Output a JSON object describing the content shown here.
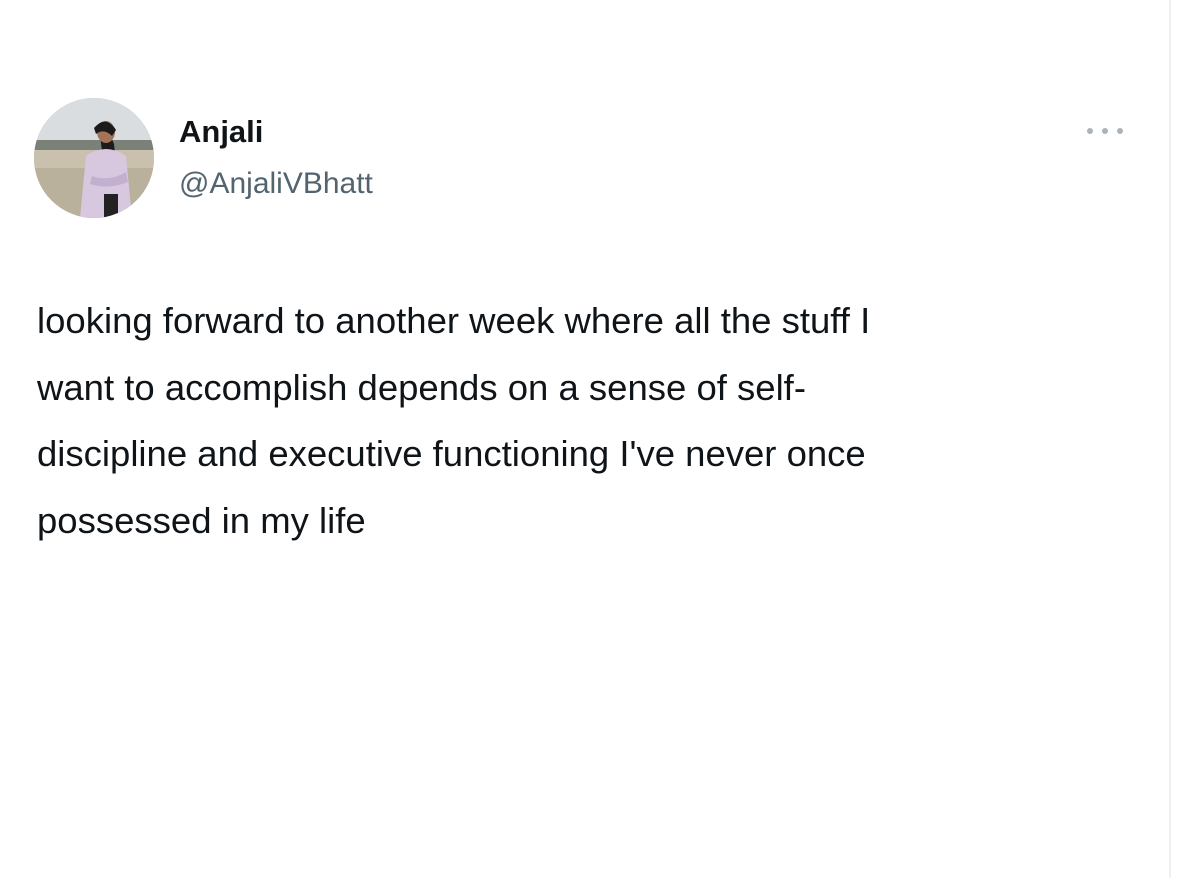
{
  "author": {
    "display_name": "Anjali",
    "handle": "@AnjaliVBhatt",
    "avatar": "profile-photo"
  },
  "menu": {
    "icon": "more-options-icon"
  },
  "tweet": {
    "text": "looking forward to another week where all the stuff I\nwant to accomplish depends on a sense of self-\ndiscipline and executive functioning I've never once\npossessed in my life"
  },
  "colors": {
    "text_primary": "#0f1419",
    "text_secondary": "#536471",
    "background": "#ffffff"
  }
}
